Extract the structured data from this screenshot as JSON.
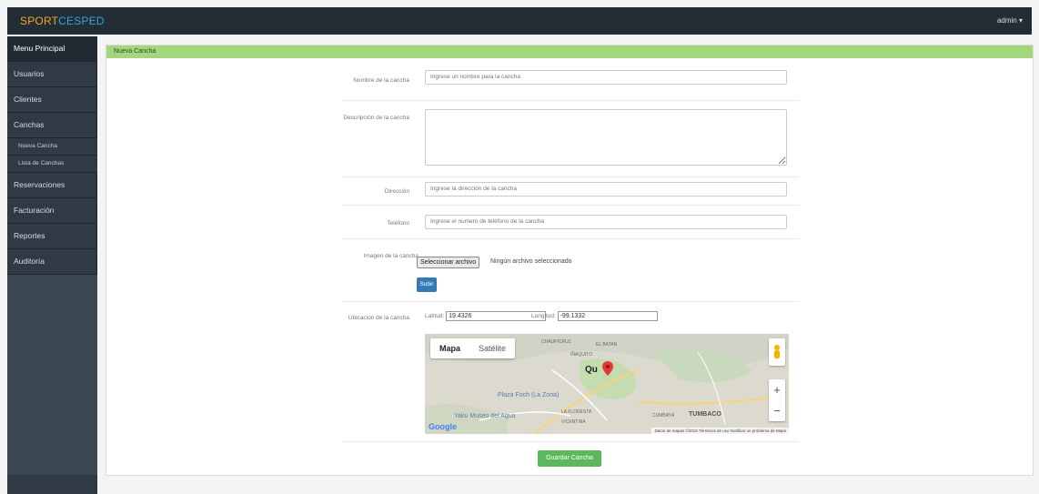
{
  "brand": {
    "part1": "SPORT",
    "part2": "CESPED"
  },
  "user_menu": "admin ▾",
  "sidebar": {
    "items": [
      {
        "label": "Menu Principal"
      },
      {
        "label": "Usuarios"
      },
      {
        "label": "Clientes"
      },
      {
        "label": "Canchas"
      },
      {
        "label": "Reservaciones"
      },
      {
        "label": "Facturación"
      },
      {
        "label": "Reportes"
      },
      {
        "label": "Auditoría"
      }
    ],
    "sub_items": [
      {
        "label": "Nueva Cancha"
      },
      {
        "label": "Lista de Canchas"
      }
    ]
  },
  "panel": {
    "title": "Nueva Cancha"
  },
  "form": {
    "name_label": "Nombre de la cancha",
    "name_placeholder": "Ingrese un nombre para la cancha",
    "desc_label": "Descripción de la cancha",
    "address_label": "Dirección",
    "address_placeholder": "Ingrese la dirección de la cancha",
    "phone_label": "Teléfono",
    "phone_placeholder": "Ingrese el numero de teléfono de la cancha",
    "image_label": "Imagen de la cancha",
    "file_button": "Seleccionar archivo",
    "file_status": "Ningún archivo seleccionado",
    "upload_button": "Subir",
    "location_label": "Ubicacion de la cancha",
    "lat_label": "Latitud:",
    "lat_value": "19.4326",
    "lng_label": "Longitud:",
    "lng_value": "-99.1332",
    "save_button": "Guardar Cancha"
  },
  "map": {
    "tab_map": "Mapa",
    "tab_satellite": "Satélite",
    "labels": {
      "chaupicruz": "CHAUPICRUZ",
      "el_batan": "EL BATAN",
      "inaquito": "IÑAQUITO",
      "quito": "Qu",
      "plaza_foch": "Plaza Foch (La Zona)",
      "yaku": "Yaku Museo del Agua",
      "la_floresta": "LA FLORESTA",
      "vicentina": "VICENTINA",
      "cumbaya": "CUMBAYÁ",
      "tumbaco": "TUMBACO"
    },
    "google": "Google",
    "attribution": "Datos de mapas ©2019   Términos de uso   Notificar un problema de Maps",
    "zoom_in": "+",
    "zoom_out": "−"
  },
  "colors": {
    "topbar": "#222d36",
    "sidebar": "#2f3a44",
    "panel_header": "#a3d77e",
    "primary_button": "#337ab7",
    "success_button": "#5cb85c"
  }
}
